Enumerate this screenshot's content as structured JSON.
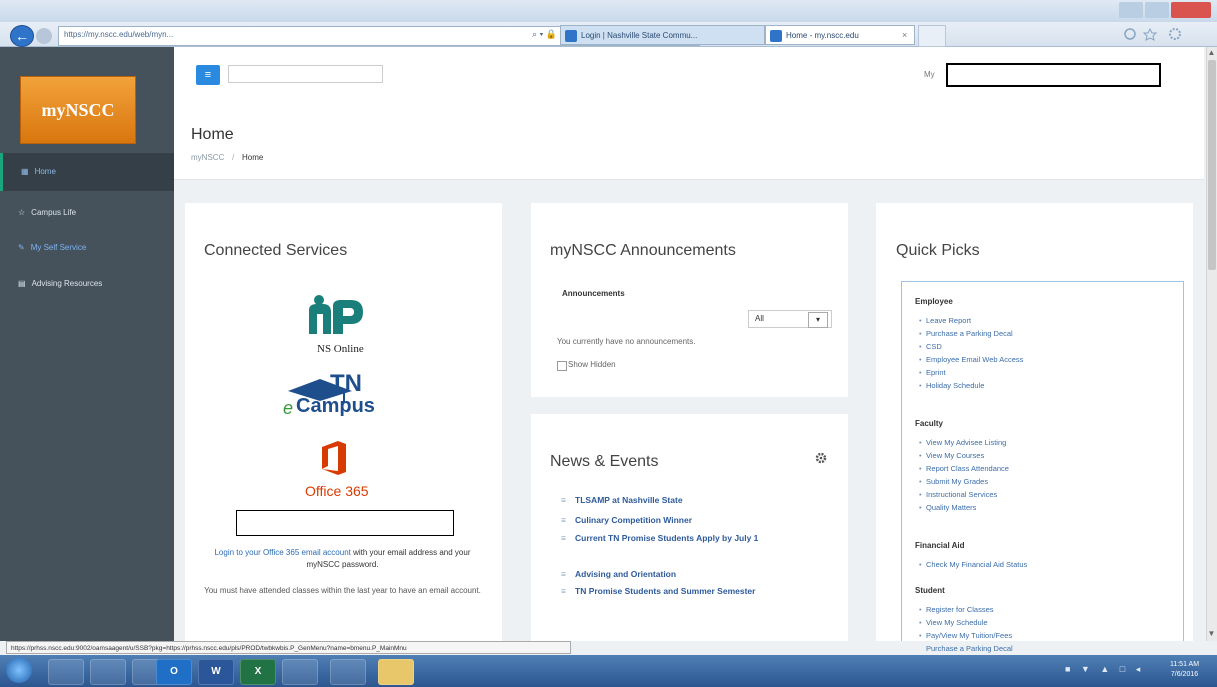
{
  "browser": {
    "address_url": "https://my.nscc.edu/web/myn...",
    "tabs": [
      {
        "label": "Login | Nashville State Commu..."
      },
      {
        "label": "Home - my.nscc.edu"
      }
    ],
    "tab_close": "×",
    "address_icons": "⌕ ▾ 🔒 C",
    "back_glyph": "←"
  },
  "sidebar": {
    "logo": "myNSCC",
    "items": [
      {
        "label": "Home",
        "icon": "grid-icon",
        "glyph": "▦"
      },
      {
        "label": "Campus Life",
        "icon": "star-icon",
        "glyph": "☆"
      },
      {
        "label": "My Self Service",
        "icon": "edit-icon",
        "glyph": "✎"
      },
      {
        "label": "Advising Resources",
        "icon": "list-icon",
        "glyph": "▤"
      }
    ]
  },
  "header": {
    "menu_glyph": "≡",
    "user_prefix": "My",
    "page_title": "Home",
    "breadcrumb": {
      "root": "myNSCC",
      "sep": "/",
      "current": "Home"
    }
  },
  "connected_services": {
    "title": "Connected Services",
    "ns_online_label": "NS Online",
    "tn_top": "TN",
    "tn_e": "e",
    "tn_bottom": "Campus",
    "office_label": "Office 365",
    "login_link": "Login to your Office 365 email account",
    "login_rest": " with your email address and your myNSCC password.",
    "note": "You must have attended classes within the last year to have an email account."
  },
  "announcements": {
    "title": "myNSCC Announcements",
    "subtitle": "Announcements",
    "filter_selected": "All",
    "filter_arrow": "▾",
    "empty_text": "You currently have no announcements.",
    "show_hidden_label": "Show Hidden"
  },
  "news": {
    "title": "News & Events",
    "items": [
      "TLSAMP at Nashville State",
      "Culinary Competition Winner",
      "Current TN Promise Students Apply by July 1",
      "Advising and Orientation",
      "TN Promise Students and Summer Semester"
    ]
  },
  "quick_picks": {
    "title": "Quick Picks",
    "sections": [
      {
        "heading": "Employee",
        "links": [
          "Leave Report",
          "Purchase a Parking Decal",
          "CSD",
          "Employee Email Web Access",
          "Eprint",
          "Holiday Schedule"
        ]
      },
      {
        "heading": "Faculty",
        "links": [
          "View My Advisee Listing",
          "View My Courses",
          "Report Class Attendance",
          "Submit My Grades",
          "Instructional Services",
          "Quality Matters"
        ]
      },
      {
        "heading": "Financial Aid",
        "links": [
          "Check My Financial Aid Status"
        ]
      },
      {
        "heading": "Student",
        "links": [
          "Register for Classes",
          "View My Schedule",
          "Pay/View My Tuition/Fees",
          "Purchase a Parking Decal"
        ]
      }
    ]
  },
  "status_bar": {
    "url": "https://prhss.nscc.edu:9002/oamsaagent/u/SSB?pkg=https://prhss.nscc.edu/pls/PROD/twbkwbis.P_GenMenu?name=bmenu.P_MainMnu"
  },
  "taskbar": {
    "apps": [
      {
        "label": "",
        "icon": "ie-icon"
      },
      {
        "label": "",
        "icon": "chrome-icon"
      },
      {
        "label": "",
        "icon": "ie-icon"
      },
      {
        "label": "O",
        "icon": "outlook-icon"
      },
      {
        "label": "W",
        "icon": "word-icon"
      },
      {
        "label": "X",
        "icon": "excel-icon"
      },
      {
        "label": "",
        "icon": "pen-icon"
      },
      {
        "label": "",
        "icon": "java-icon"
      },
      {
        "label": "",
        "icon": "folder-icon"
      }
    ],
    "tray": "■ ▼ ▲ □ ◂",
    "time": "11:51 AM",
    "date": "7/6/2016"
  },
  "colors": {
    "sidebar_bg": "#45525c",
    "accent_green": "#1aa67d",
    "link_blue": "#2e5b9a",
    "logo_orange": "#e88a22",
    "office_red": "#d83b01"
  }
}
